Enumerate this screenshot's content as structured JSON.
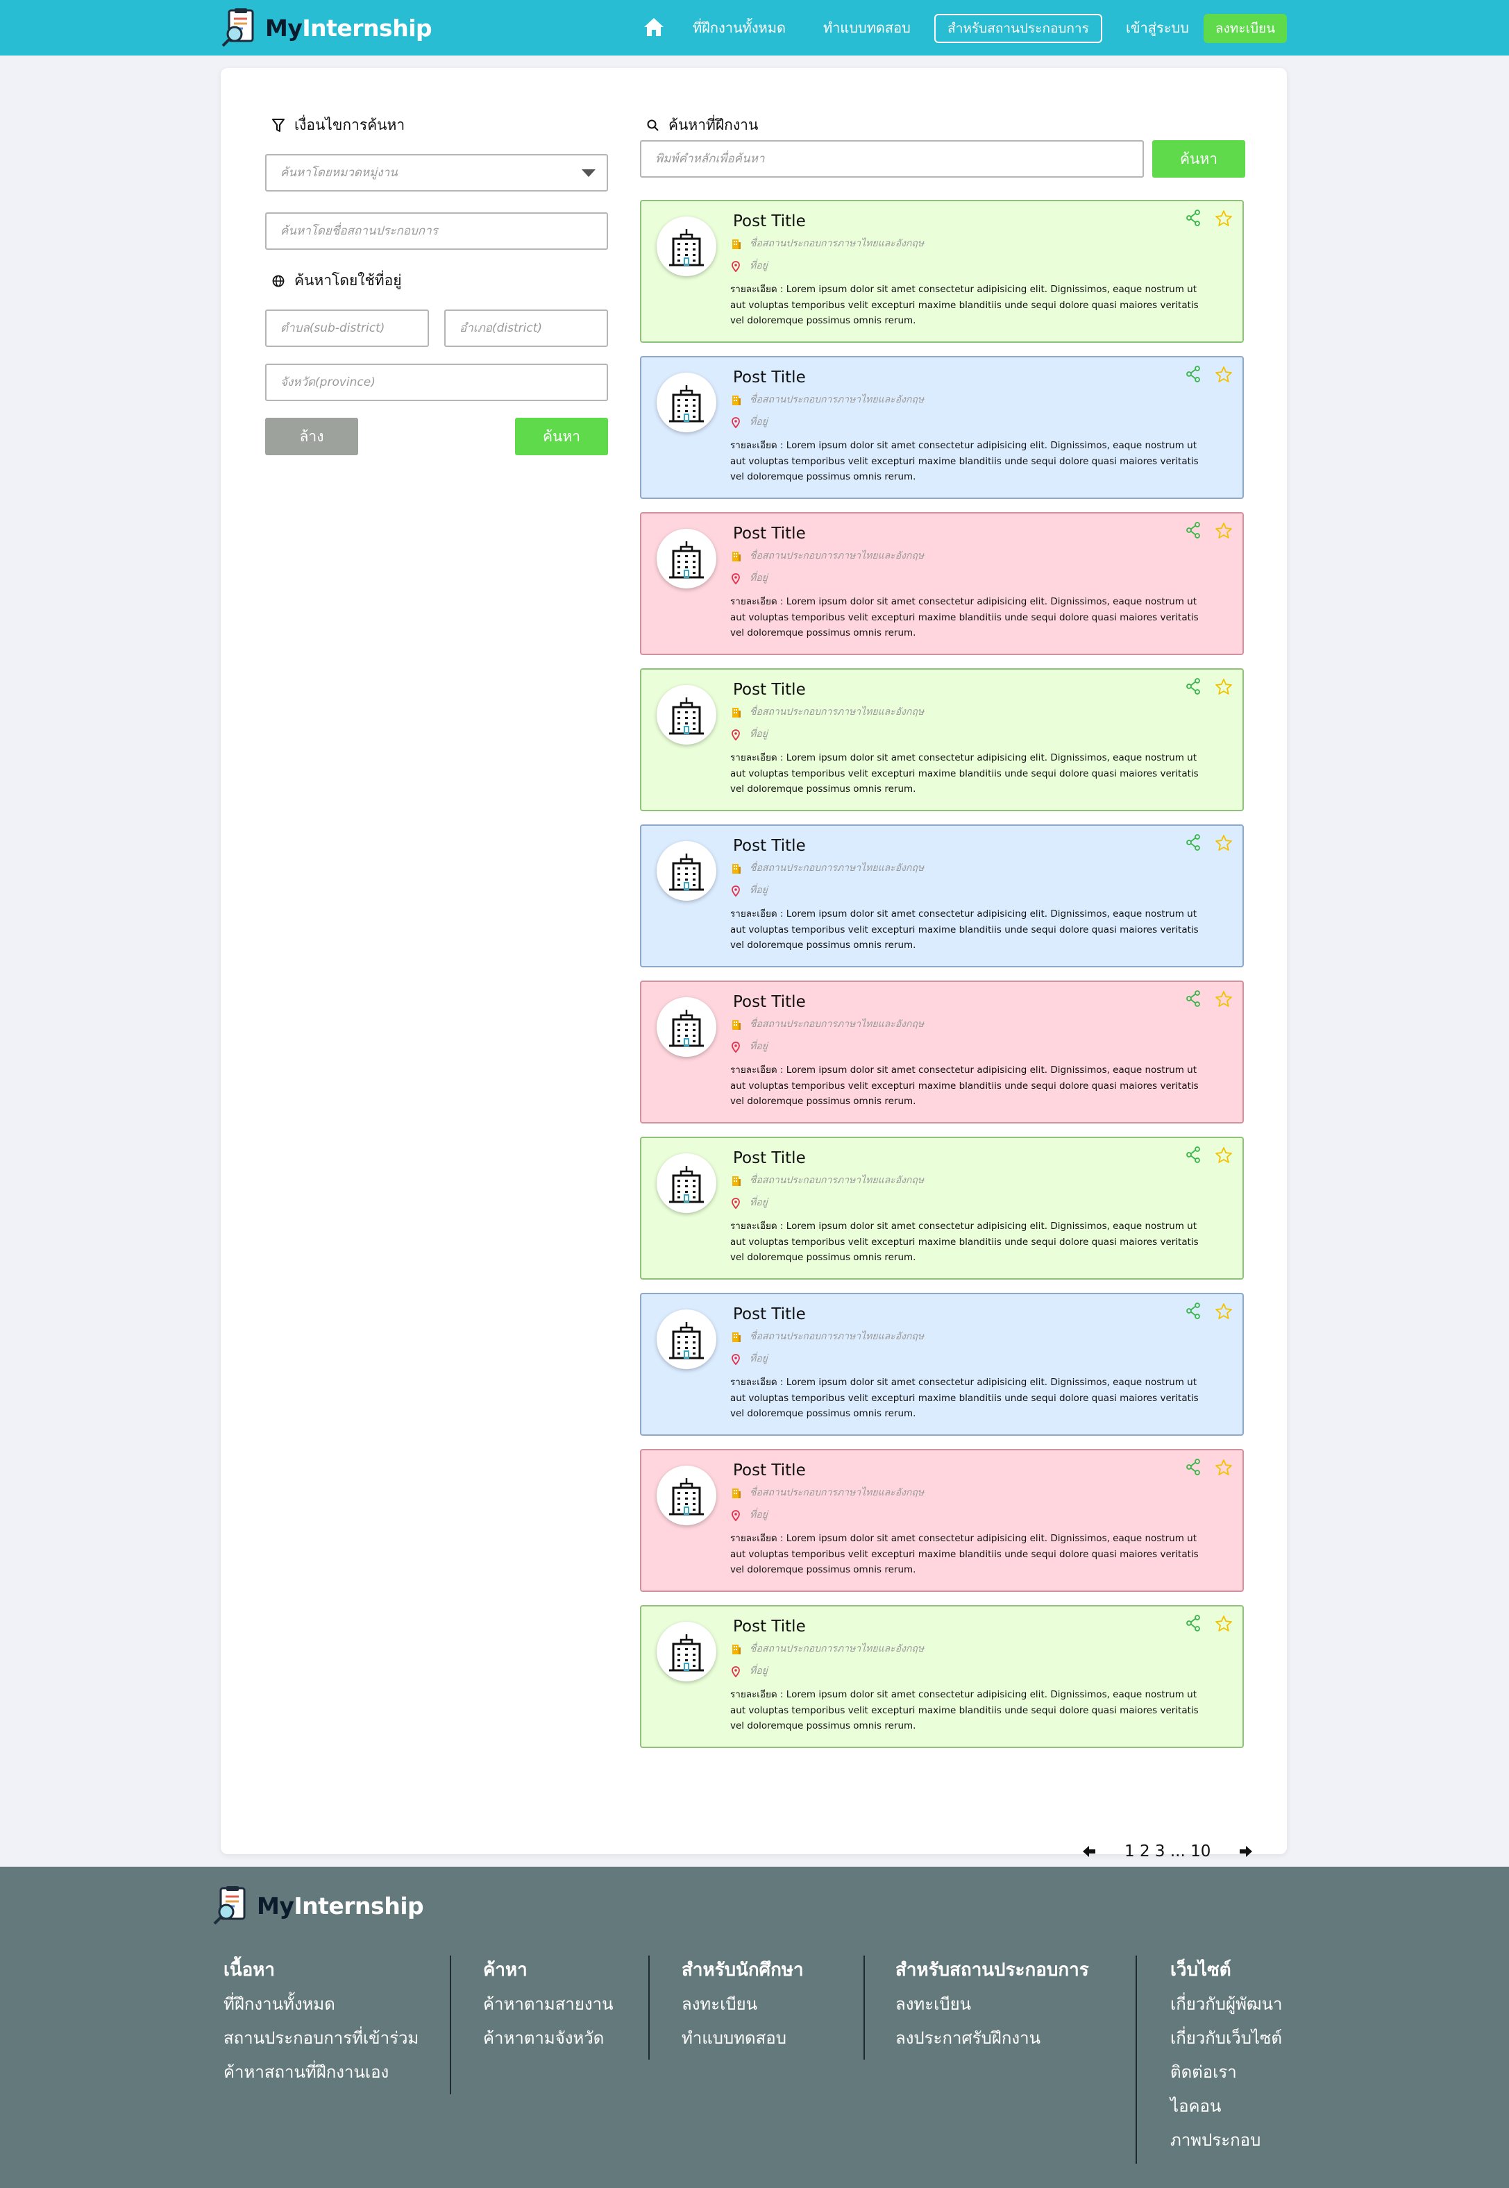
{
  "header": {
    "brand_my": "My",
    "brand_internship": "Internship",
    "home_icon": "home-icon",
    "nav_all_internships": "ที่ฝึกงานทั้งหมด",
    "nav_quiz": "ทำแบบทดสอบ",
    "nav_for_business": "สำหรับสถานประกอบการ",
    "nav_login": "เข้าสู่ระบบ",
    "nav_register": "ลงทะเบียน"
  },
  "filters": {
    "title": "เงื่อนไขการค้นหา",
    "category_placeholder": "ค้นหาโดยหมวดหมู่งาน",
    "company_placeholder": "ค้นหาโดยชื่อสถานประกอบการ",
    "address_title": "ค้นหาโดยใช้ที่อยู่",
    "subdistrict_placeholder": "ตำบล(sub-district)",
    "district_placeholder": "อำเภอ(district)",
    "province_placeholder": "จังหวัด(province)",
    "clear_label": "ล้าง",
    "search_label": "ค้นหา"
  },
  "search": {
    "title": "ค้นหาที่ฝึกงาน",
    "placeholder": "พิมพ์คำหลักเพื่อค้นหา",
    "button_label": "ค้นหา"
  },
  "colors": {
    "navbar": "#29bdd3",
    "accent_green": "#5fda4b",
    "footer": "#64797b",
    "card_green": "#eaffd9",
    "card_blue": "#dcecff",
    "card_pink": "#ffd6de"
  },
  "posts": [
    {
      "title": "Post Title",
      "company": "ชื่อสถานประกอบการภาษาไทยและอังกฤษ",
      "address": "ที่อยู่",
      "description": "รายละเอียด : Lorem ipsum dolor sit amet consectetur adipisicing elit. Dignissimos, eaque nostrum ut aut voluptas temporibus velit excepturi maxime blanditiis unde sequi dolore quasi maiores veritatis vel doloremque possimus omnis rerum.",
      "color": "green"
    },
    {
      "title": "Post Title",
      "company": "ชื่อสถานประกอบการภาษาไทยและอังกฤษ",
      "address": "ที่อยู่",
      "description": "รายละเอียด : Lorem ipsum dolor sit amet consectetur adipisicing elit. Dignissimos, eaque nostrum ut aut voluptas temporibus velit excepturi maxime blanditiis unde sequi dolore quasi maiores veritatis vel doloremque possimus omnis rerum.",
      "color": "blue"
    },
    {
      "title": "Post Title",
      "company": "ชื่อสถานประกอบการภาษาไทยและอังกฤษ",
      "address": "ที่อยู่",
      "description": "รายละเอียด : Lorem ipsum dolor sit amet consectetur adipisicing elit. Dignissimos, eaque nostrum ut aut voluptas temporibus velit excepturi maxime blanditiis unde sequi dolore quasi maiores veritatis vel doloremque possimus omnis rerum.",
      "color": "pink"
    },
    {
      "title": "Post Title",
      "company": "ชื่อสถานประกอบการภาษาไทยและอังกฤษ",
      "address": "ที่อยู่",
      "description": "รายละเอียด : Lorem ipsum dolor sit amet consectetur adipisicing elit. Dignissimos, eaque nostrum ut aut voluptas temporibus velit excepturi maxime blanditiis unde sequi dolore quasi maiores veritatis vel doloremque possimus omnis rerum.",
      "color": "green"
    },
    {
      "title": "Post Title",
      "company": "ชื่อสถานประกอบการภาษาไทยและอังกฤษ",
      "address": "ที่อยู่",
      "description": "รายละเอียด : Lorem ipsum dolor sit amet consectetur adipisicing elit. Dignissimos, eaque nostrum ut aut voluptas temporibus velit excepturi maxime blanditiis unde sequi dolore quasi maiores veritatis vel doloremque possimus omnis rerum.",
      "color": "blue"
    },
    {
      "title": "Post Title",
      "company": "ชื่อสถานประกอบการภาษาไทยและอังกฤษ",
      "address": "ที่อยู่",
      "description": "รายละเอียด : Lorem ipsum dolor sit amet consectetur adipisicing elit. Dignissimos, eaque nostrum ut aut voluptas temporibus velit excepturi maxime blanditiis unde sequi dolore quasi maiores veritatis vel doloremque possimus omnis rerum.",
      "color": "pink"
    },
    {
      "title": "Post Title",
      "company": "ชื่อสถานประกอบการภาษาไทยและอังกฤษ",
      "address": "ที่อยู่",
      "description": "รายละเอียด : Lorem ipsum dolor sit amet consectetur adipisicing elit. Dignissimos, eaque nostrum ut aut voluptas temporibus velit excepturi maxime blanditiis unde sequi dolore quasi maiores veritatis vel doloremque possimus omnis rerum.",
      "color": "green"
    },
    {
      "title": "Post Title",
      "company": "ชื่อสถานประกอบการภาษาไทยและอังกฤษ",
      "address": "ที่อยู่",
      "description": "รายละเอียด : Lorem ipsum dolor sit amet consectetur adipisicing elit. Dignissimos, eaque nostrum ut aut voluptas temporibus velit excepturi maxime blanditiis unde sequi dolore quasi maiores veritatis vel doloremque possimus omnis rerum.",
      "color": "blue"
    },
    {
      "title": "Post Title",
      "company": "ชื่อสถานประกอบการภาษาไทยและอังกฤษ",
      "address": "ที่อยู่",
      "description": "รายละเอียด : Lorem ipsum dolor sit amet consectetur adipisicing elit. Dignissimos, eaque nostrum ut aut voluptas temporibus velit excepturi maxime blanditiis unde sequi dolore quasi maiores veritatis vel doloremque possimus omnis rerum.",
      "color": "pink"
    },
    {
      "title": "Post Title",
      "company": "ชื่อสถานประกอบการภาษาไทยและอังกฤษ",
      "address": "ที่อยู่",
      "description": "รายละเอียด : Lorem ipsum dolor sit amet consectetur adipisicing elit. Dignissimos, eaque nostrum ut aut voluptas temporibus velit excepturi maxime blanditiis unde sequi dolore quasi maiores veritatis vel doloremque possimus omnis rerum.",
      "color": "green"
    }
  ],
  "pagination": {
    "pages_text": "1 2 3 ... 10",
    "prev_icon": "arrow-left-icon",
    "next_icon": "arrow-right-icon"
  },
  "footer": {
    "brand_my": "My",
    "brand_internship": "Internship",
    "columns": [
      {
        "heading": "เนื้อหา",
        "links": [
          "ที่ฝึกงานทั้งหมด",
          "สถานประกอบการที่เข้าร่วม",
          "ค้าหาสถานที่ฝึกงานเอง"
        ]
      },
      {
        "heading": "ค้าหา",
        "links": [
          "ค้าหาตามสายงาน",
          "ค้าหาตามจังหวัด"
        ]
      },
      {
        "heading": "สำหรับนักศึกษา",
        "links": [
          "ลงทะเบียน",
          "ทำแบบทดสอบ"
        ]
      },
      {
        "heading": "สำหรับสถานประกอบการ",
        "links": [
          "ลงทะเบียน",
          "ลงประกาศรับฝึกงาน"
        ]
      },
      {
        "heading": "เว็บไซต์",
        "links": [
          "เกี่ยวกับผู้พัฒนา",
          "เกี่ยวกับเว็บไซต์",
          "ติดต่อเรา",
          "ไอคอน",
          "ภาพประกอบ"
        ]
      }
    ]
  }
}
